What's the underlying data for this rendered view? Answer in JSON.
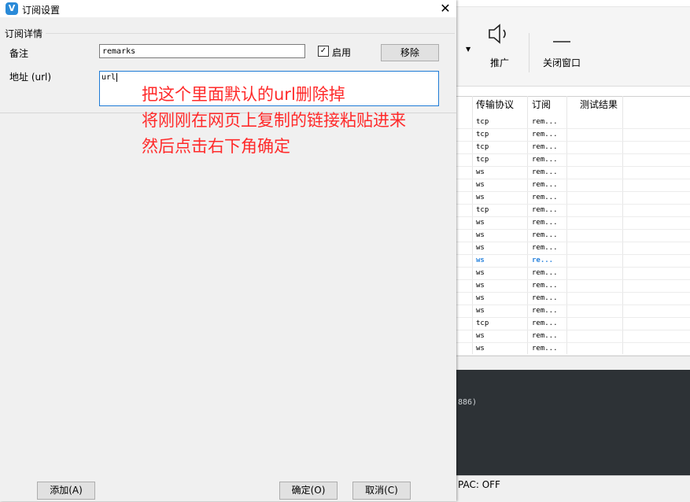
{
  "dialog": {
    "title": "订阅设置",
    "app_icon": "V",
    "close_glyph": "✕",
    "group_label": "订阅详情",
    "remarks_label": "备注",
    "remarks_value": "remarks",
    "enable_label": "启用",
    "enable_checked": true,
    "remove_button": "移除",
    "url_label": "地址 (url)",
    "url_value": "url",
    "add_button": "添加(A)",
    "ok_button": "确定(O)",
    "cancel_button": "取消(C)"
  },
  "annotation": {
    "line1": "把这个里面默认的url删除掉",
    "line2": "将刚刚在网页上复制的链接粘贴进来",
    "line3": "然后点击右下角确定",
    "color": "#ff2a2a"
  },
  "background_window": {
    "toolbar": {
      "promote_label": "推广",
      "promote_icon": "speaker-icon",
      "close_window_label": "关闭窗口",
      "close_window_icon": "dash-icon"
    },
    "table": {
      "headers": [
        "传输协议",
        "订阅",
        "测试结果"
      ],
      "rows": [
        {
          "protocol": "tcp",
          "sub": "rem..."
        },
        {
          "protocol": "tcp",
          "sub": "rem..."
        },
        {
          "protocol": "tcp",
          "sub": "rem..."
        },
        {
          "protocol": "tcp",
          "sub": "rem..."
        },
        {
          "protocol": "ws",
          "sub": "rem..."
        },
        {
          "protocol": "ws",
          "sub": "rem..."
        },
        {
          "protocol": "ws",
          "sub": "rem..."
        },
        {
          "protocol": "tcp",
          "sub": "rem..."
        },
        {
          "protocol": "ws",
          "sub": "rem..."
        },
        {
          "protocol": "ws",
          "sub": "rem..."
        },
        {
          "protocol": "ws",
          "sub": "rem..."
        },
        {
          "protocol": "ws",
          "sub": "re..."
        },
        {
          "protocol": "ws",
          "sub": "rem..."
        },
        {
          "protocol": "ws",
          "sub": "rem..."
        },
        {
          "protocol": "ws",
          "sub": "rem..."
        },
        {
          "protocol": "ws",
          "sub": "rem..."
        },
        {
          "protocol": "tcp",
          "sub": "rem..."
        },
        {
          "protocol": "ws",
          "sub": "rem..."
        },
        {
          "protocol": "ws",
          "sub": "rem..."
        }
      ],
      "selected_row": 11,
      "selected_color": "#2e86de"
    },
    "log_fragment": "886)",
    "status_pac": "PAC:  OFF"
  }
}
